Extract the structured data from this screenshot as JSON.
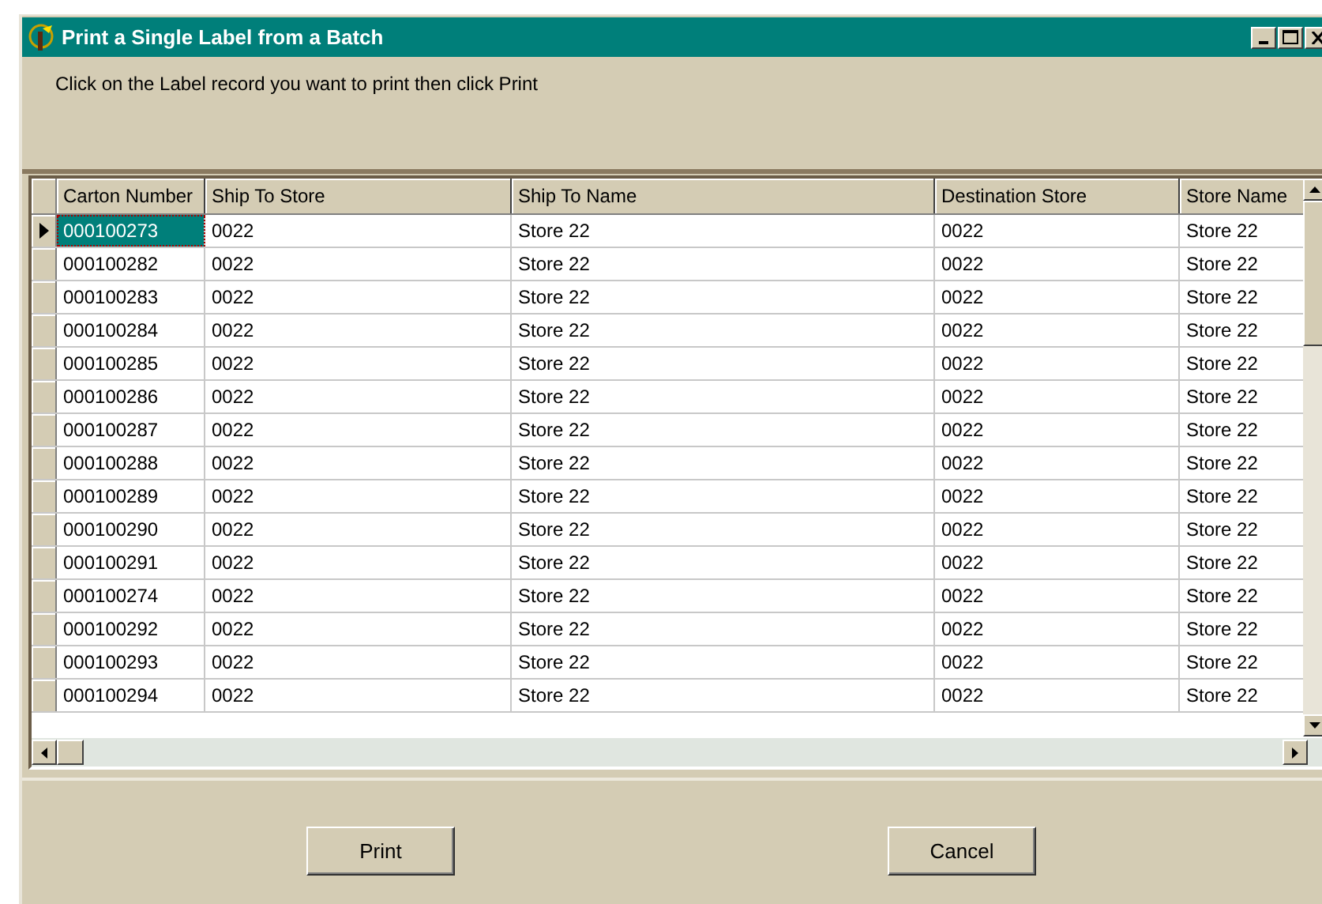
{
  "window": {
    "title": "Print a Single Label from a Batch"
  },
  "instruction": "Click on the Label record you want to print then click Print",
  "table": {
    "columns": [
      "Carton Number",
      "Ship To Store",
      "Ship To Name",
      "Destination Store",
      "Store Name"
    ],
    "rows": [
      {
        "cells": [
          "000100273",
          "0022",
          "Store 22",
          "0022",
          "Store 22"
        ],
        "selected": true
      },
      {
        "cells": [
          "000100282",
          "0022",
          "Store 22",
          "0022",
          "Store 22"
        ],
        "selected": false
      },
      {
        "cells": [
          "000100283",
          "0022",
          "Store 22",
          "0022",
          "Store 22"
        ],
        "selected": false
      },
      {
        "cells": [
          "000100284",
          "0022",
          "Store 22",
          "0022",
          "Store 22"
        ],
        "selected": false
      },
      {
        "cells": [
          "000100285",
          "0022",
          "Store 22",
          "0022",
          "Store 22"
        ],
        "selected": false
      },
      {
        "cells": [
          "000100286",
          "0022",
          "Store 22",
          "0022",
          "Store 22"
        ],
        "selected": false
      },
      {
        "cells": [
          "000100287",
          "0022",
          "Store 22",
          "0022",
          "Store 22"
        ],
        "selected": false
      },
      {
        "cells": [
          "000100288",
          "0022",
          "Store 22",
          "0022",
          "Store 22"
        ],
        "selected": false
      },
      {
        "cells": [
          "000100289",
          "0022",
          "Store 22",
          "0022",
          "Store 22"
        ],
        "selected": false
      },
      {
        "cells": [
          "000100290",
          "0022",
          "Store 22",
          "0022",
          "Store 22"
        ],
        "selected": false
      },
      {
        "cells": [
          "000100291",
          "0022",
          "Store 22",
          "0022",
          "Store 22"
        ],
        "selected": false
      },
      {
        "cells": [
          "000100274",
          "0022",
          "Store 22",
          "0022",
          "Store 22"
        ],
        "selected": false
      },
      {
        "cells": [
          "000100292",
          "0022",
          "Store 22",
          "0022",
          "Store 22"
        ],
        "selected": false
      },
      {
        "cells": [
          "000100293",
          "0022",
          "Store 22",
          "0022",
          "Store 22"
        ],
        "selected": false
      },
      {
        "cells": [
          "000100294",
          "0022",
          "Store 22",
          "0022",
          "Store 22"
        ],
        "selected": false
      }
    ]
  },
  "buttons": [
    "Print",
    "Cancel"
  ]
}
